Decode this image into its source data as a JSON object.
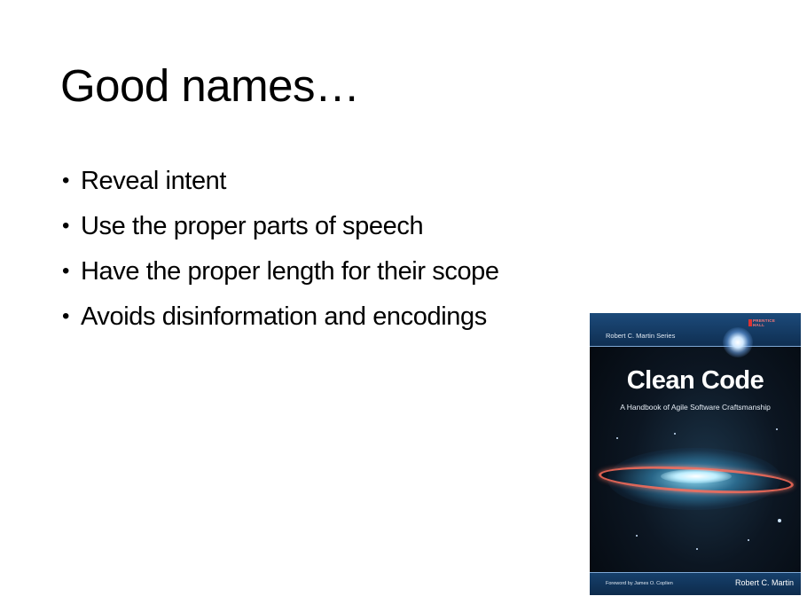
{
  "slide": {
    "title": "Good names…",
    "bullets": [
      "Reveal intent",
      "Use the proper parts of speech",
      "Have the proper length for their scope",
      "Avoids disinformation and encodings"
    ],
    "bullet_symbol": "•"
  },
  "book_cover": {
    "series": "Robert C. Martin Series",
    "publisher": [
      "PRENTICE",
      "HALL"
    ],
    "title": "Clean Code",
    "subtitle": "A Handbook of Agile Software Craftsmanship",
    "foreword": "Foreword by James O. Coplien",
    "author": "Robert C. Martin"
  },
  "colors": {
    "background": "#ffffff",
    "text": "#000000",
    "cover_band": "#1c4a7a",
    "cover_dark": "#03070c",
    "galaxy_ring": "#ff6e5a"
  }
}
